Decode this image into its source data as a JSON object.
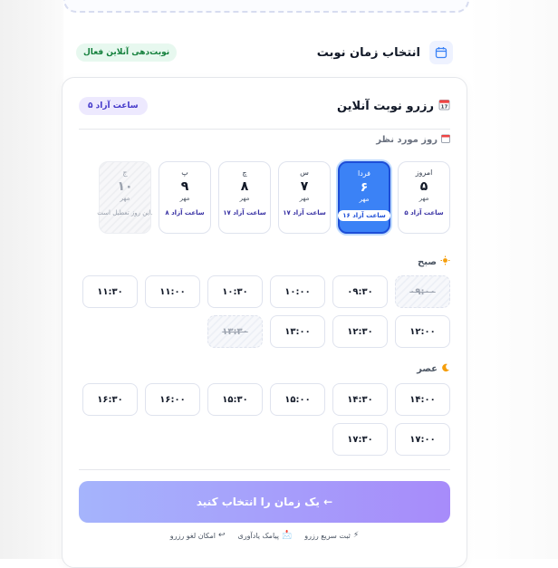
{
  "header": {
    "title": "انتخاب زمان نوبت",
    "badge": "نوبت‌دهی آنلاین فعال"
  },
  "card": {
    "title": "رزرو نوبت آنلاین",
    "free_badge": "۵ ساعت آزاد",
    "day_label": "روز مورد نظر",
    "days": [
      {
        "name": "امروز",
        "num": "۵",
        "month": "مهر",
        "free": "۵ ساعت آزاد"
      },
      {
        "name": "فردا",
        "num": "۶",
        "month": "مهر",
        "free": "۱۶ ساعت آزاد"
      },
      {
        "name": "س",
        "num": "۷",
        "month": "مهر",
        "free": "۱۷ ساعت آزاد"
      },
      {
        "name": "چ",
        "num": "۸",
        "month": "مهر",
        "free": "۱۷ ساعت آزاد"
      },
      {
        "name": "پ",
        "num": "۹",
        "month": "مهر",
        "free": "۸ ساعت آزاد"
      },
      {
        "name": "ج",
        "num": "۱۰",
        "month": "مهر",
        "free": "این روز تعطیل است."
      }
    ],
    "morning": {
      "label": "صبح",
      "slots": [
        "۰۹:۰۰",
        "۰۹:۳۰",
        "۱۰:۰۰",
        "۱۰:۳۰",
        "۱۱:۰۰",
        "۱۱:۳۰",
        "۱۲:۰۰",
        "۱۲:۳۰",
        "۱۳:۰۰",
        "۱۳:۳۰"
      ]
    },
    "afternoon": {
      "label": "عصر",
      "slots": [
        "۱۴:۰۰",
        "۱۴:۳۰",
        "۱۵:۰۰",
        "۱۵:۳۰",
        "۱۶:۰۰",
        "۱۶:۳۰",
        "۱۷:۰۰",
        "۱۷:۳۰"
      ]
    },
    "cta": "یک زمان را انتخاب کنید ←",
    "features": [
      {
        "icon": "⚡",
        "label": "ثبت سریع رزرو"
      },
      {
        "icon": "📩",
        "label": "پیامک یادآوری"
      },
      {
        "icon": "↩",
        "label": "امکان لغو رزرو"
      }
    ]
  },
  "colors": {
    "accent": "#3b82f6",
    "cta_start": "#a5b4fc",
    "cta_end": "#a78bfa",
    "active_badge": "#15803d"
  }
}
